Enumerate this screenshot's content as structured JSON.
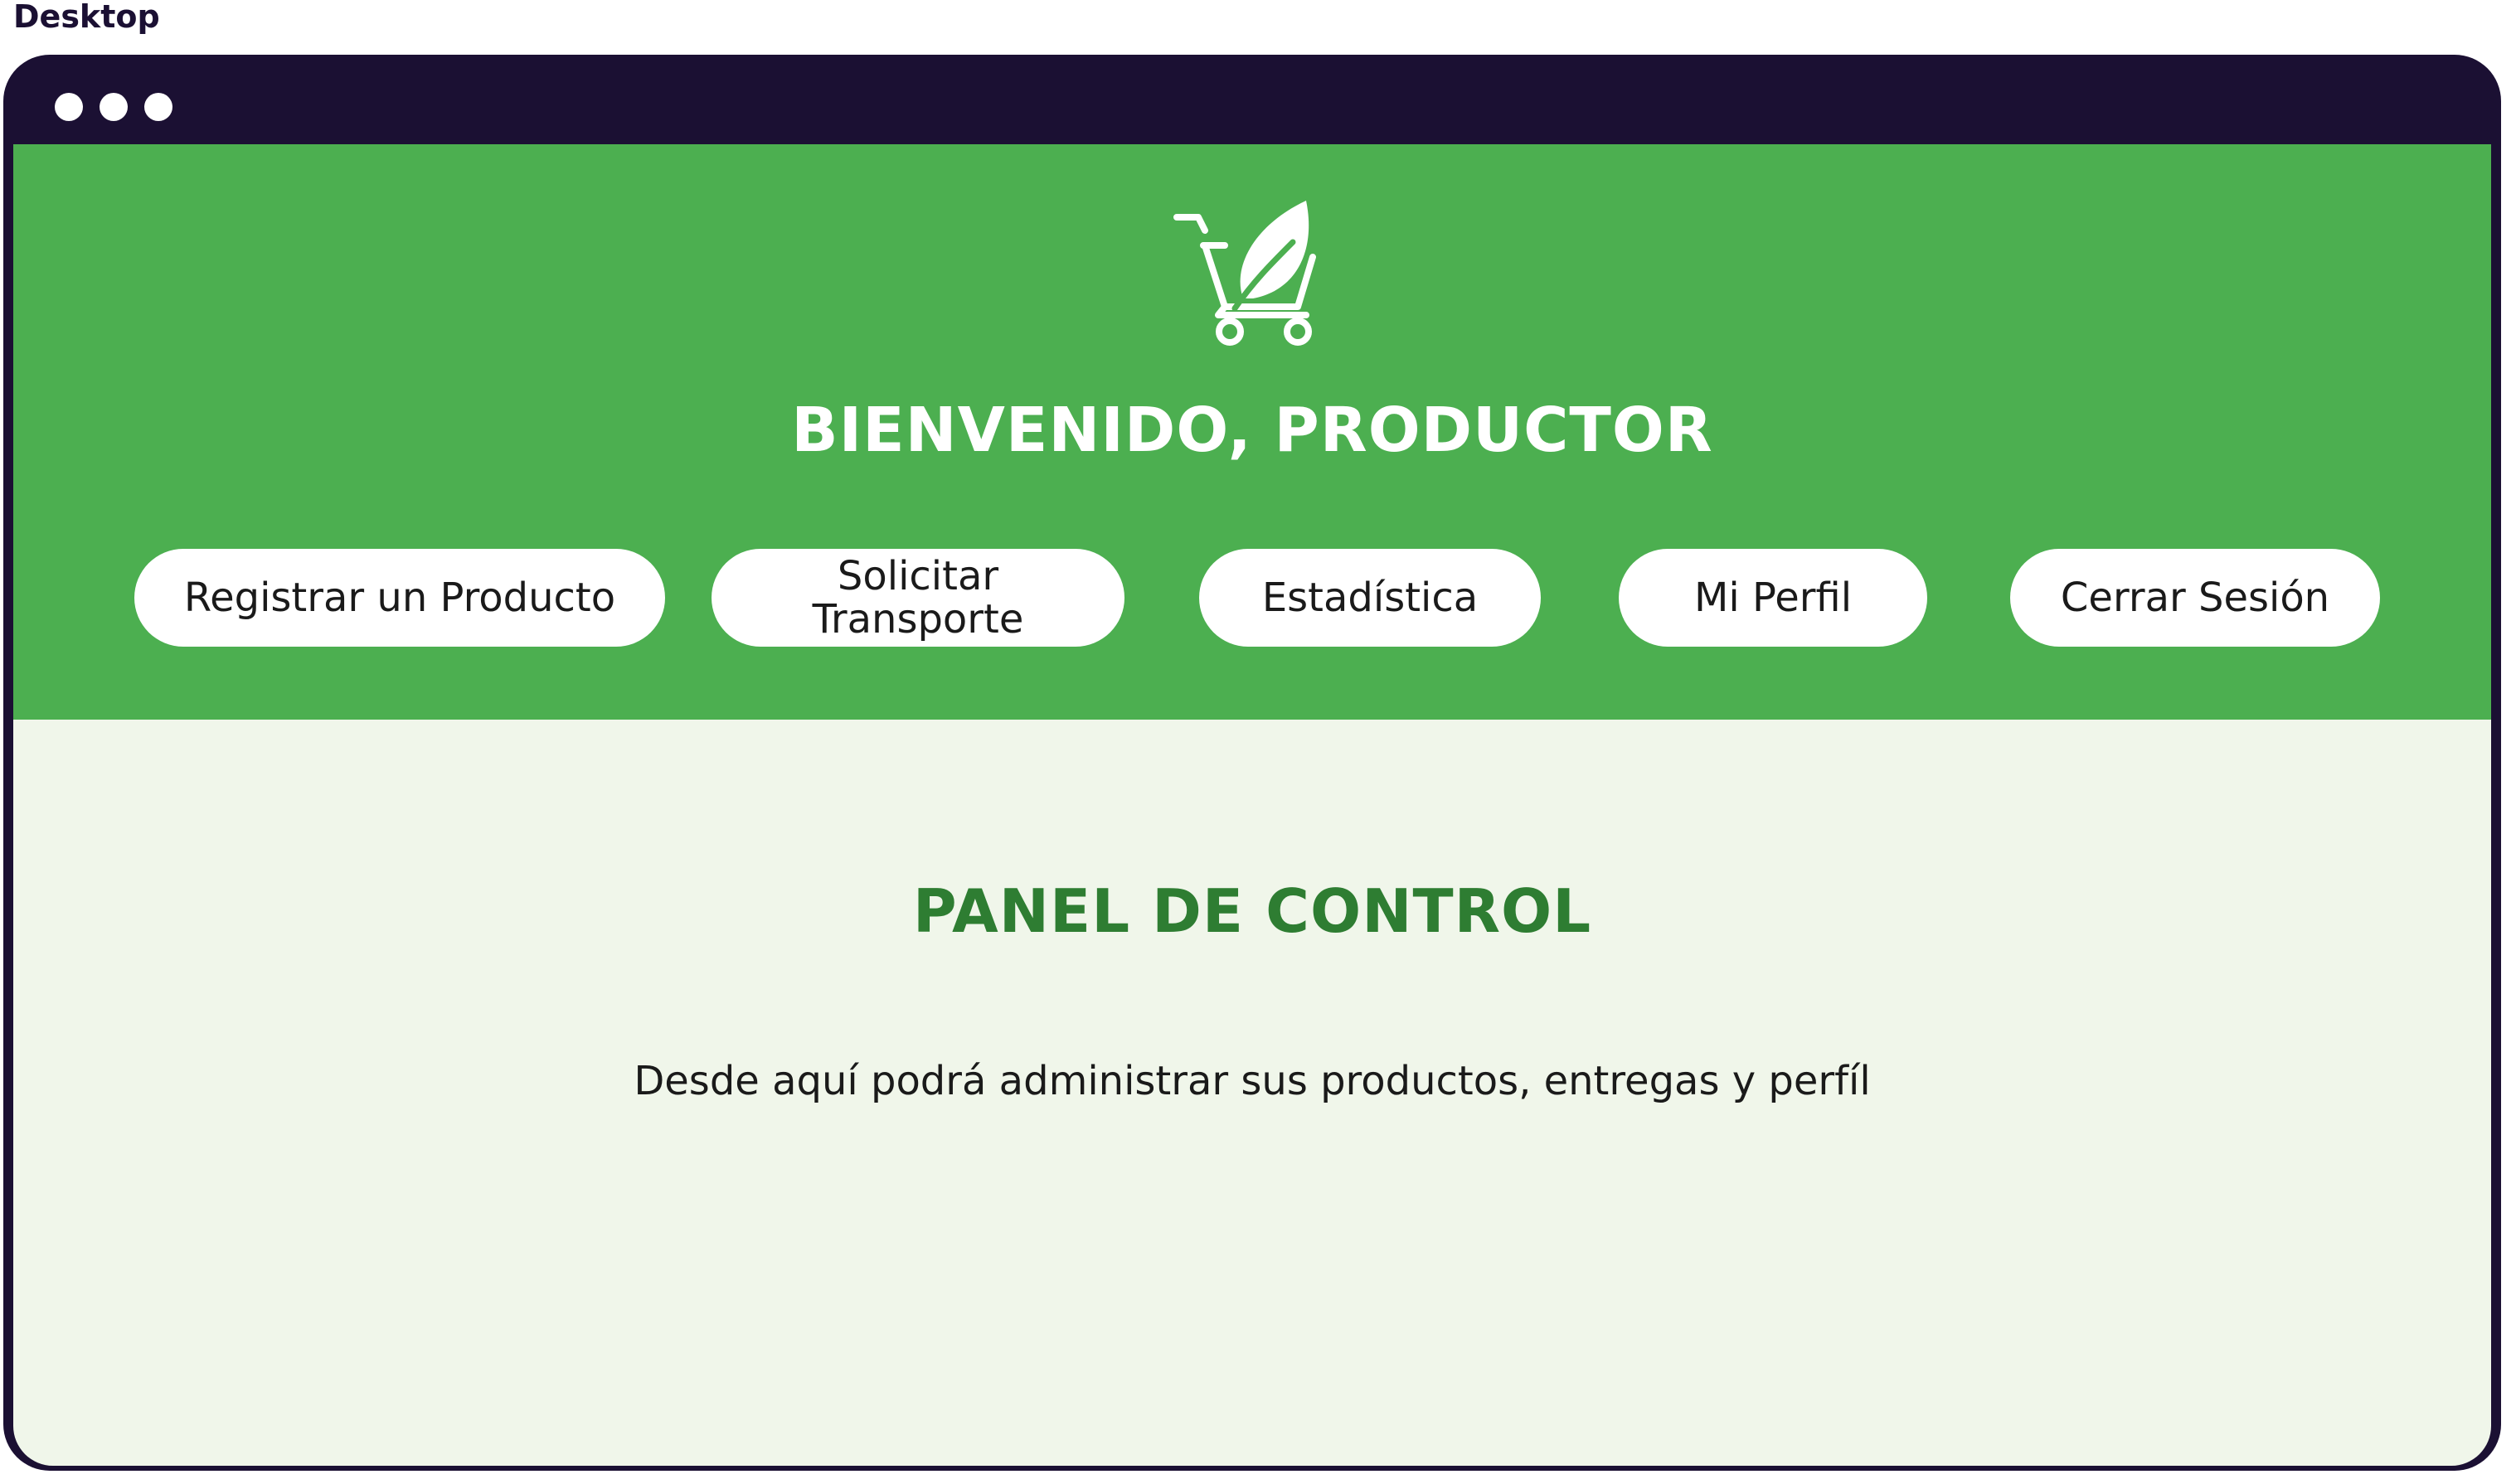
{
  "frame": {
    "label": "Desktop"
  },
  "header": {
    "logo_icon": "cart-leaf-icon",
    "welcome": "BIENVENIDO, PRODUCTOR"
  },
  "nav": {
    "items": [
      {
        "label": "Registrar un Producto"
      },
      {
        "label": "Solicitar Transporte"
      },
      {
        "label": "Estadística"
      },
      {
        "label": "Mi Perfil"
      },
      {
        "label": "Cerrar Sesión"
      }
    ]
  },
  "main": {
    "title": "PANEL DE CONTROL",
    "description": "Desde aquí podrá administrar sus productos, entregas y perfíl"
  },
  "colors": {
    "header_green": "#4caf50",
    "title_green": "#2e7d32",
    "content_bg": "#f0f6ea",
    "window_frame": "#1b1033"
  }
}
